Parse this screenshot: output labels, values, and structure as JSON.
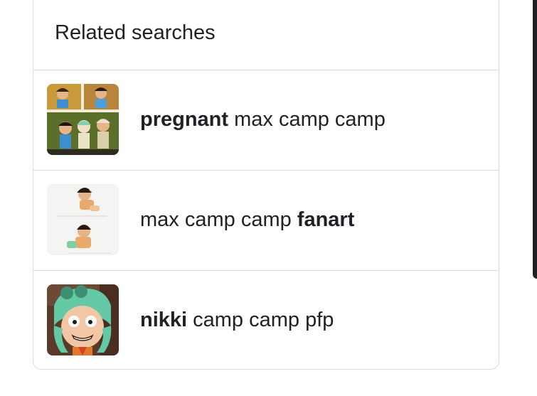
{
  "related_searches": {
    "title": "Related searches",
    "items": [
      {
        "bold": "pregnant",
        "text": " max camp camp",
        "thumb_icon": "collage-thumbnail-icon"
      },
      {
        "text": "max camp camp ",
        "bold": "fanart",
        "thumb_icon": "fanart-thumbnail-icon"
      },
      {
        "bold": "nikki",
        "text": " camp camp pfp",
        "thumb_icon": "nikki-thumbnail-icon"
      }
    ]
  },
  "colors": {
    "border": "#dadce0",
    "text": "#202124",
    "background": "#ffffff"
  }
}
